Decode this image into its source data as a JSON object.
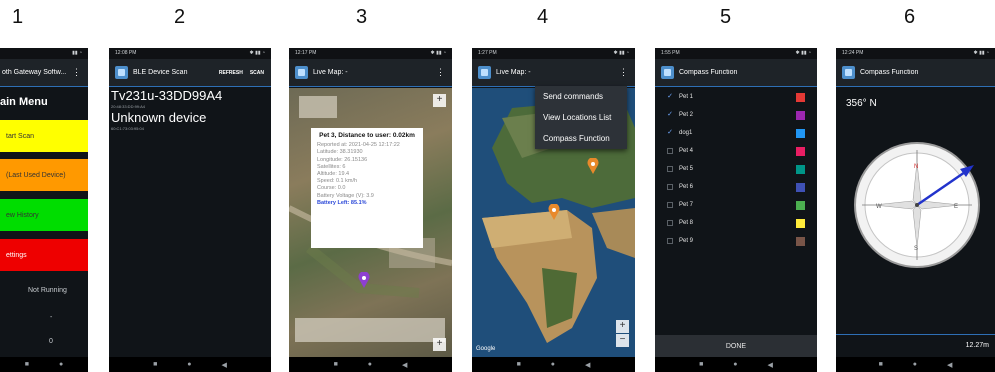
{
  "step_numbers": [
    "1",
    "2",
    "3",
    "4",
    "5",
    "6"
  ],
  "phone1": {
    "status_time": "",
    "app_title": "oth Gateway Softw...",
    "menu_title": "ain Menu",
    "buttons": [
      {
        "label": "tart Scan",
        "color": "#ffff00"
      },
      {
        "label": "(Last Used Device)",
        "color": "#ff9900"
      },
      {
        "label": "ew History",
        "color": "#00dd00"
      },
      {
        "label": "ettings",
        "color": "#ee0000"
      }
    ],
    "status": "Not Running",
    "value1": "-",
    "value2": "0"
  },
  "phone2": {
    "status_time": "12:08 PM",
    "app_title": "BLE Device Scan",
    "refresh_label": "REFRESH",
    "scan_label": "SCAN",
    "devices": [
      {
        "name": "Tv231u-33DD99A4",
        "mac": "20:48:33:DD:99:A4"
      },
      {
        "name": "Unknown device",
        "mac": "60:C1:73:03:95:04"
      }
    ]
  },
  "phone3": {
    "status_time": "12:17 PM",
    "app_title": "Live Map: -",
    "popup": {
      "title": "Pet 3, Distance to user: 0.02km",
      "lines": [
        "Reported at: 2021-04-25 12:17:22",
        "Latitude: 38.31930",
        "Longitude: 26.15136",
        "Satellites: 6",
        "Altitude: 19.4",
        "Speed: 0.1 km/h",
        "Course: 0.0",
        "Battery Voltage (V): 3.9"
      ],
      "battery": "Battery Left: 85.1%"
    },
    "pin_color": "#8e3fd1"
  },
  "phone4": {
    "status_time": "1:27 PM",
    "app_title": "Live Map: -",
    "menu": [
      "Send commands",
      "View Locations List",
      "Compass Function"
    ],
    "google_label": "Google",
    "pin_color": "#e8892b"
  },
  "phone5": {
    "status_time": "1:55 PM",
    "app_title": "Compass Function",
    "pets": [
      {
        "label": "Pet 1",
        "checked": true,
        "color": "#e53935"
      },
      {
        "label": "Pet 2",
        "checked": true,
        "color": "#9c27b0"
      },
      {
        "label": "dog1",
        "checked": true,
        "color": "#2196f3"
      },
      {
        "label": "Pet 4",
        "checked": false,
        "color": "#e91e63"
      },
      {
        "label": "Pet 5",
        "checked": false,
        "color": "#009688"
      },
      {
        "label": "Pet 6",
        "checked": false,
        "color": "#3f51b5"
      },
      {
        "label": "Pet 7",
        "checked": false,
        "color": "#4caf50"
      },
      {
        "label": "Pet 8",
        "checked": false,
        "color": "#ffeb3b"
      },
      {
        "label": "Pet 9",
        "checked": false,
        "color": "#795548"
      }
    ],
    "done_label": "DONE"
  },
  "phone6": {
    "status_time": "12:24 PM",
    "app_title": "Compass Function",
    "heading": "356° N",
    "distance": "12.27m",
    "needle_color": "#2233cc"
  }
}
